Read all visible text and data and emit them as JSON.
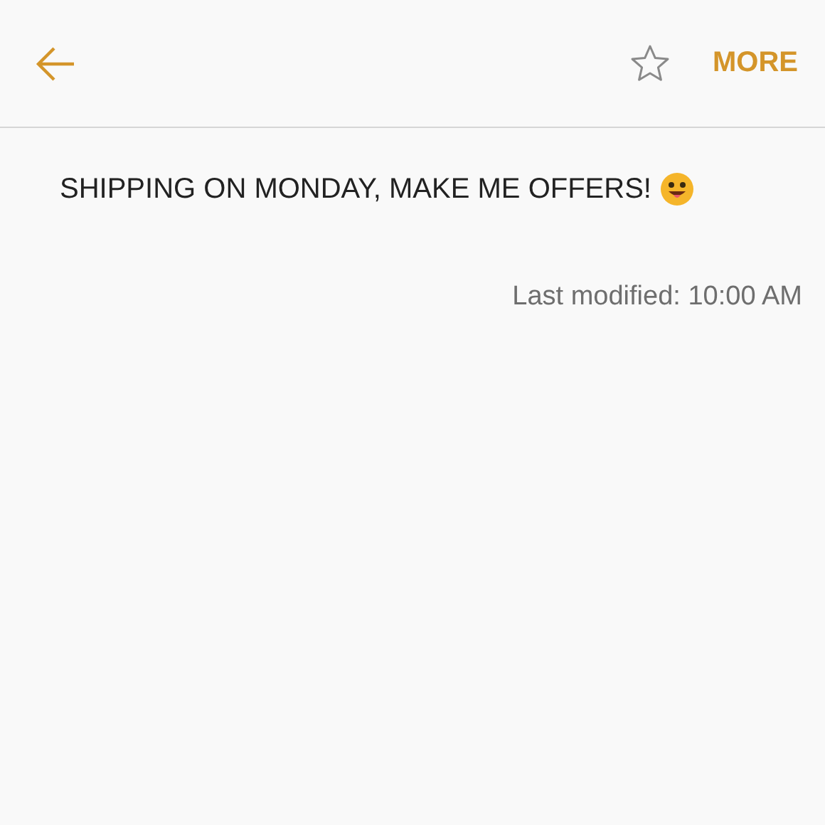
{
  "toolbar": {
    "favorite": false,
    "more_label": "MORE"
  },
  "note": {
    "text": "SHIPPING ON MONDAY, MAKE ME OFFERS!",
    "last_modified": "Last modified: 10:00 AM"
  }
}
